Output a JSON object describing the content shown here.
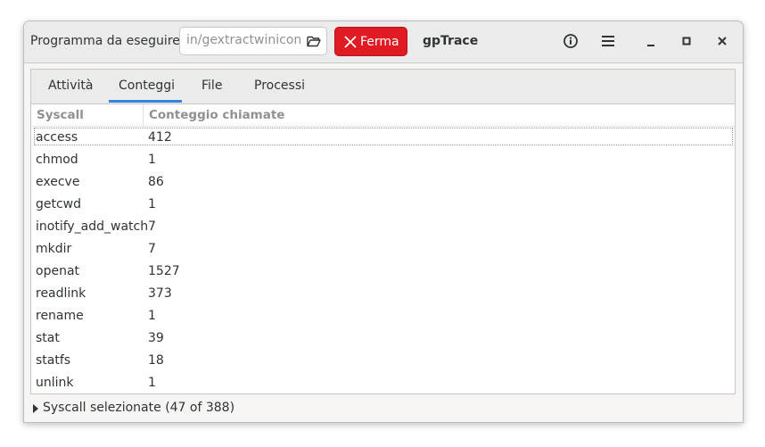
{
  "header": {
    "program_label": "Programma da eseguire:",
    "program_value": "in/gextractwinicons",
    "stop_label": "Ferma",
    "title": "gpTrace"
  },
  "icons": {
    "folder": "folder-open-icon",
    "stop": "close-x-icon",
    "about": "info-icon",
    "menu": "hamburger-menu-icon",
    "minimize": "minimize-icon",
    "maximize": "maximize-icon",
    "close": "close-icon"
  },
  "colors": {
    "accent": "#3584e4",
    "stop": "#e01b24"
  },
  "tabs": [
    {
      "label": "Attività"
    },
    {
      "label": "Conteggi"
    },
    {
      "label": "File"
    },
    {
      "label": "Processi"
    }
  ],
  "active_tab": "Conteggi",
  "table": {
    "columns": [
      "Syscall",
      "Conteggio chiamate"
    ],
    "rows": [
      {
        "name": "access",
        "count": "412"
      },
      {
        "name": "chmod",
        "count": "1"
      },
      {
        "name": "execve",
        "count": "86"
      },
      {
        "name": "getcwd",
        "count": "1"
      },
      {
        "name": "inotify_add_watch",
        "count": "7"
      },
      {
        "name": "mkdir",
        "count": "7"
      },
      {
        "name": "openat",
        "count": "1527"
      },
      {
        "name": "readlink",
        "count": "373"
      },
      {
        "name": "rename",
        "count": "1"
      },
      {
        "name": "stat",
        "count": "39"
      },
      {
        "name": "statfs",
        "count": "18"
      },
      {
        "name": "unlink",
        "count": "1"
      }
    ]
  },
  "footer": {
    "expander_label": "Syscall selezionate (47 of 388)"
  }
}
